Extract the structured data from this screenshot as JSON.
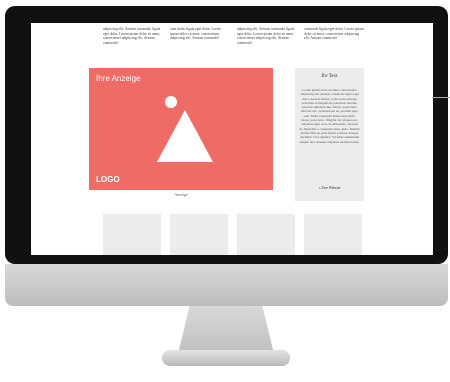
{
  "text_columns": [
    "adipiscing elit. Aenean commodo ligula eget dolor. Lorem ipsum dolor sit amet, consectetuer adipiscing elit. Aenean commodo!",
    "cum modo ligula eget dolor. Lorem ipsum dolor sit amet, consectetuer adipiscing elit. Aenean commodo!",
    "adipiscing elit. Aenean commodo ligula eget dolor. Lorem ipsum dolor sit amet, consectetuer adipiscing elit. Aenean commodo!",
    "commodo ligula eget dolor. Lorem ipsum dolor sit amet, consectetuer adipiscing elit. Aenean commodo!"
  ],
  "ad": {
    "label": "Ihre Anzeige",
    "logo": "LOGO",
    "caption": "Anzeige",
    "color": "#ee6b66"
  },
  "sidebar": {
    "title": "Ihr Text",
    "body": "Lorem ipsum dolor sit amet, consectetuer adipiscing elit. Aenean commodo ligula eget dolor. Aenean massa. Cum sociis natoque penatibus et magnis dis parturient montes, nascetur ridiculus mus. Donec quam felis, ultricies nec, pellentesque eu, pretium quis, sem. Nulla consequat massa quis enim. Donec pede justo, fringilla vel, aliquet nec, vulputate eget, arcu. In enim justo, rhoncus ut, imperdiet a, venenatis vitae, justo. Nullam dictum felis eu pede mollis pretium. Integer tincidunt. Cras dapibus. Vivamus elementum semper nisi. Aenean vulputate eleifend tellus.",
    "link": "» Zere Website"
  },
  "device": {
    "logo_icon": "apple-logo-icon"
  }
}
